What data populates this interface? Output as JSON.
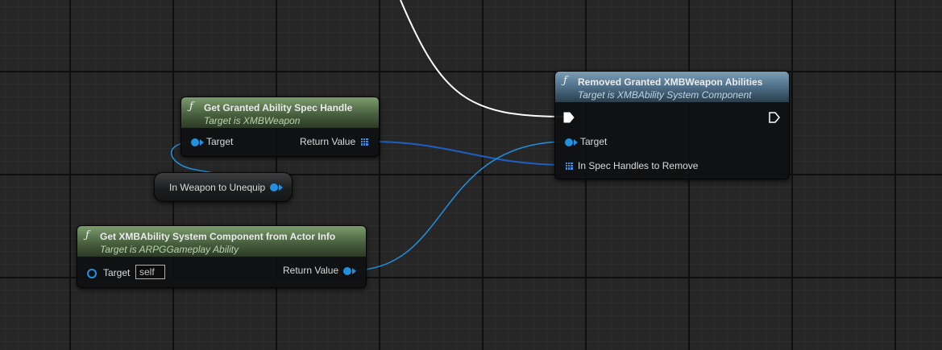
{
  "colors": {
    "canvas": "#262626",
    "wire_object": "#2190e0",
    "wire_array": "#1f5fc4",
    "wire_exec": "#ffffff",
    "header_pure": "#49603f",
    "header_impure": "#4a6a82"
  },
  "nodes": {
    "spec_handle": {
      "title": "Get Granted Ability Spec Handle",
      "subtitle": "Target is XMBWeapon",
      "target_label": "Target",
      "return_label": "Return Value"
    },
    "weapon_var": {
      "label": "In Weapon to Unequip"
    },
    "asc": {
      "title": "Get XMBAbility System Component from Actor Info",
      "subtitle": "Target is ARPGGameplay Ability",
      "target_label": "Target",
      "target_value": "self",
      "return_label": "Return Value"
    },
    "remove": {
      "title": "Removed Granted XMBWeapon Abilities",
      "subtitle": "Target is XMBAbility System Component",
      "target_label": "Target",
      "handles_label": "In Spec Handles to Remove"
    }
  },
  "icons": [
    "function-icon",
    "exec-in-icon",
    "exec-out-icon",
    "object-pin-icon",
    "array-pin-icon"
  ]
}
